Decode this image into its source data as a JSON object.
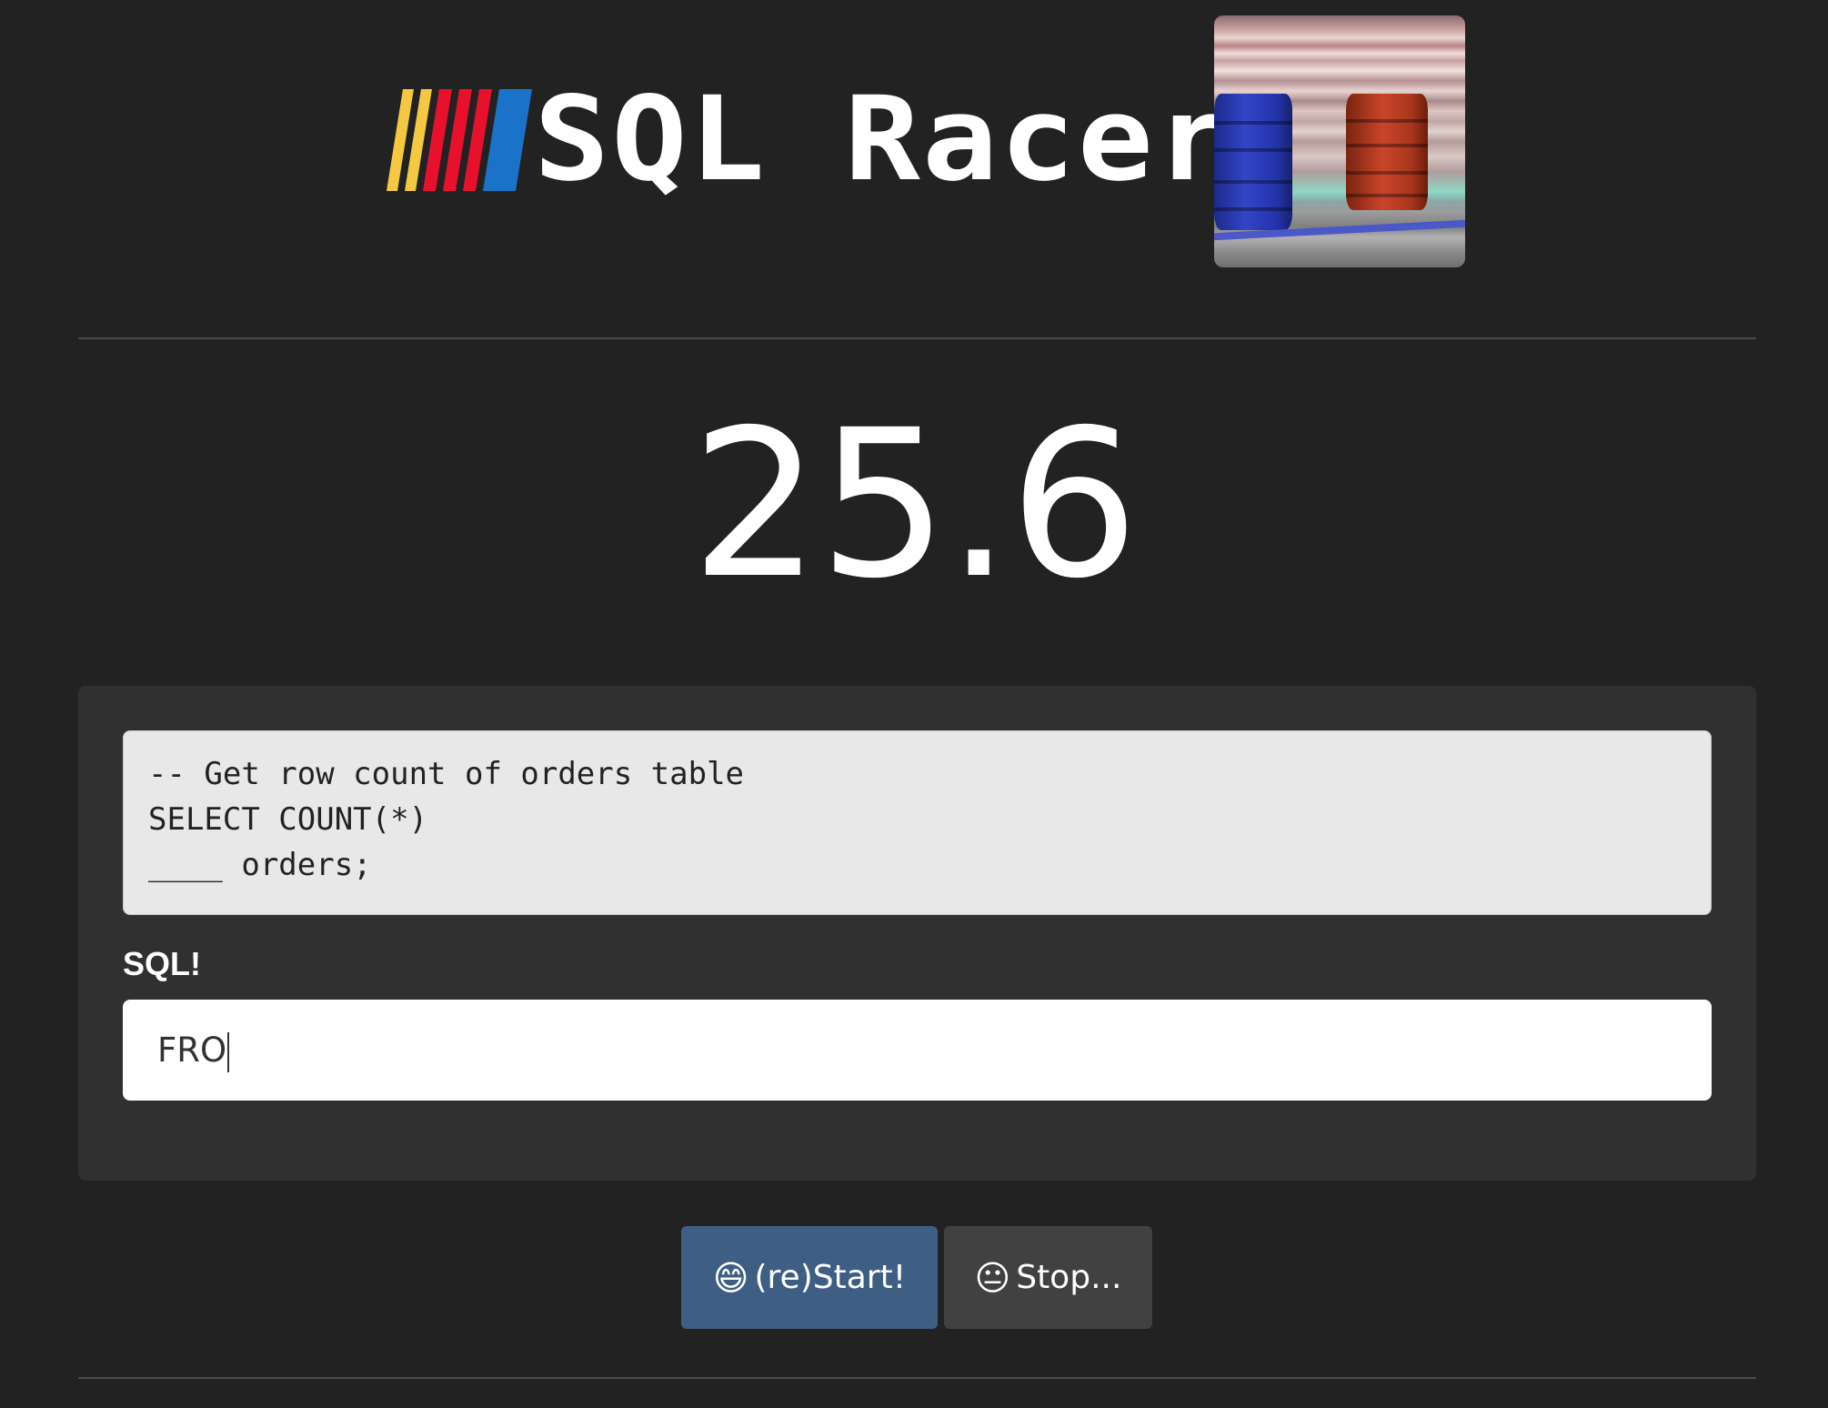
{
  "header": {
    "logo_text": "SQL Racer",
    "logo_stripe_colors": [
      "#f5c842",
      "#e8112d",
      "#1a73c8"
    ]
  },
  "timer": {
    "value": "25.6"
  },
  "challenge": {
    "code_lines": [
      "-- Get row count of orders table",
      "SELECT COUNT(*)",
      "____ orders;"
    ]
  },
  "input": {
    "label": "SQL!",
    "value": "FRO"
  },
  "buttons": {
    "start": {
      "icon": "grinning-face-icon",
      "label": "(re)Start!"
    },
    "stop": {
      "icon": "neutral-face-icon",
      "label": "Stop..."
    }
  },
  "colors": {
    "background": "#222222",
    "panel": "#303030",
    "start_button": "#3f5e83",
    "stop_button": "#414141"
  }
}
